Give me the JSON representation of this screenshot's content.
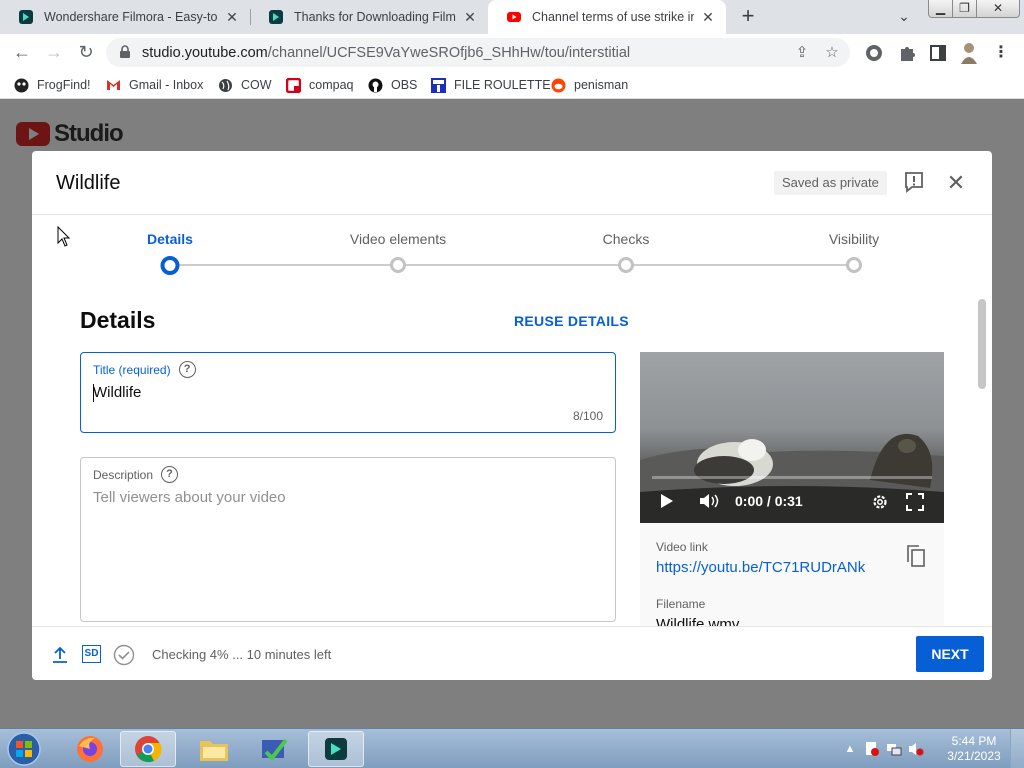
{
  "browser": {
    "tabs": [
      {
        "title": "Wondershare Filmora - Easy-to-U",
        "icon": "filmora-icon"
      },
      {
        "title": "Thanks for Downloading Filmora",
        "icon": "filmora-icon"
      },
      {
        "title": "Channel terms of use strike interi",
        "icon": "youtube-icon",
        "active": true
      }
    ],
    "new_tab": "+",
    "url_host": "studio.youtube.com",
    "url_path": "/channel/UCFSE9VaYweSROfjb6_SHhHw/tou/interstitial"
  },
  "bookmarks": [
    {
      "label": "FrogFind!",
      "icon": "frog-icon"
    },
    {
      "label": "Gmail - Inbox",
      "icon": "gmail-icon"
    },
    {
      "label": "COW",
      "icon": "globe-icon"
    },
    {
      "label": "compaq",
      "icon": "compaq-icon"
    },
    {
      "label": "OBS",
      "icon": "github-icon"
    },
    {
      "label": "FILE ROULETTE",
      "icon": "mft-icon"
    },
    {
      "label": "penisman",
      "icon": "reddit-icon"
    }
  ],
  "studio": {
    "logo_text": "Studio"
  },
  "dialog": {
    "title": "Wildlife",
    "saved_status": "Saved as private",
    "steps": [
      {
        "label": "Details",
        "active": true
      },
      {
        "label": "Video elements",
        "active": false
      },
      {
        "label": "Checks",
        "active": false
      },
      {
        "label": "Visibility",
        "active": false
      }
    ],
    "section_title": "Details",
    "reuse_label": "REUSE DETAILS",
    "title_field": {
      "label": "Title (required)",
      "value": "Wildlife",
      "count": "8/100"
    },
    "description_field": {
      "label": "Description",
      "placeholder": "Tell viewers about your video"
    },
    "video": {
      "time": "0:00 / 0:31",
      "progress": 0
    },
    "video_link_label": "Video link",
    "video_link": "https://youtu.be/TC71RUDrANk",
    "filename_label": "Filename",
    "filename": "Wildlife.wmv",
    "footer_status": "Checking 4% ... 10 minutes left",
    "sd_label": "SD",
    "next_label": "NEXT"
  },
  "taskbar": {
    "time": "5:44 PM",
    "date": "3/21/2023"
  },
  "colors": {
    "accent": "#065fd4",
    "tabstrip": "#dee1e6",
    "overlay": "#7f7f7f"
  }
}
